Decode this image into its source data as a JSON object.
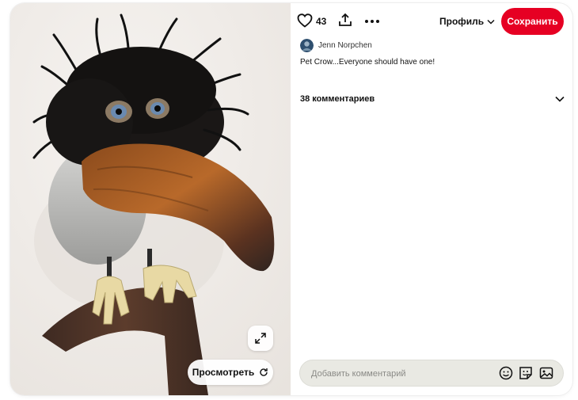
{
  "toolbar": {
    "like_count": "43",
    "profile_label": "Профиль",
    "save_label": "Сохранить"
  },
  "pin": {
    "author_name": "Jenn Norpchen",
    "description": "Pet Crow...Everyone should have one!",
    "view_label": "Просмотреть"
  },
  "comments": {
    "title": "38 комментариев",
    "input_placeholder": "Добавить комментарий"
  },
  "colors": {
    "accent": "#e60023",
    "comment_bg": "#e9e9e3"
  },
  "icons": [
    "heart-icon",
    "share-icon",
    "more-icon",
    "chevron-down-icon",
    "expand-icon",
    "refresh-icon",
    "emoji-icon",
    "sticker-icon",
    "photo-icon"
  ]
}
